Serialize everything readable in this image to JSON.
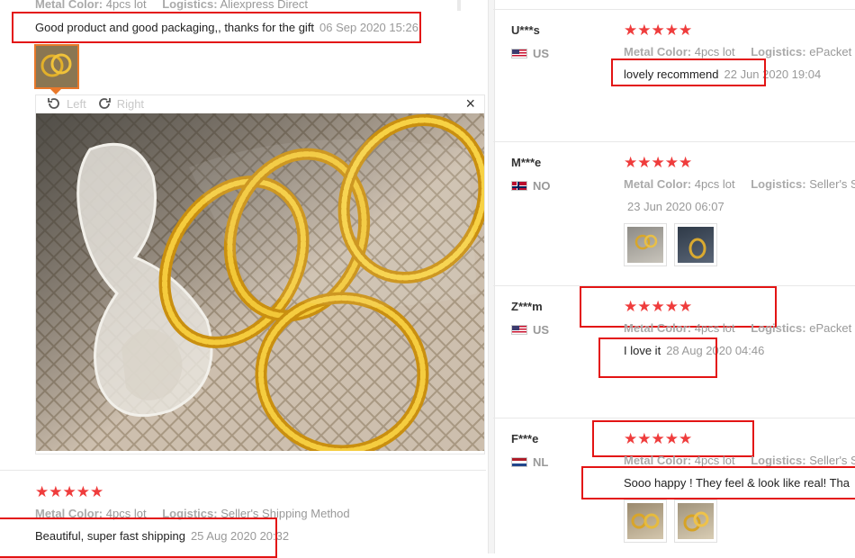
{
  "left_review_top": {
    "meta": {
      "color_label": "Metal Color:",
      "color_value": "4pcs lot",
      "logistics_label": "Logistics:",
      "logistics_value": "Aliexpress Direct"
    },
    "text": "Good product and good packaging,, thanks for the gift",
    "date": "06 Sep 2020 15:26"
  },
  "viewer": {
    "rotate_left": "Left",
    "rotate_right": "Right",
    "close": "×"
  },
  "left_review_bottom": {
    "stars": "★★★★★",
    "meta": {
      "color_label": "Metal Color:",
      "color_value": "4pcs lot",
      "logistics_label": "Logistics:",
      "logistics_value": "Seller's Shipping Method"
    },
    "text": "Beautiful, super fast shipping",
    "date": "25 Aug 2020 20:32"
  },
  "right_reviews": [
    {
      "user": "U***s",
      "country": "US",
      "stars": "★★★★★",
      "color_label": "Metal Color:",
      "color_value": "4pcs lot",
      "logistics_label": "Logistics:",
      "logistics_value": "ePacket",
      "text": "lovely recommend",
      "date": "22 Jun 2020 19:04"
    },
    {
      "user": "M***e",
      "country": "NO",
      "stars": "★★★★★",
      "color_label": "Metal Color:",
      "color_value": "4pcs lot",
      "logistics_label": "Logistics:",
      "logistics_value": "Seller's Sh",
      "text": "",
      "date": "23 Jun 2020 06:07"
    },
    {
      "user": "Z***m",
      "country": "US",
      "stars": "★★★★★",
      "color_label": "Metal Color:",
      "color_value": "4pcs lot",
      "logistics_label": "Logistics:",
      "logistics_value": "ePacket",
      "text": "I love it",
      "date": "28 Aug 2020 04:46"
    },
    {
      "user": "F***e",
      "country": "NL",
      "stars": "★★★★★",
      "color_label": "Metal Color:",
      "color_value": "4pcs lot",
      "logistics_label": "Logistics:",
      "logistics_value": "Seller's Sh",
      "text": "Sooo happy ! They feel & look like real! Tha",
      "date": ""
    }
  ],
  "colors": {
    "star": "#ef3c3c",
    "highlight": "#e31414",
    "meta_text": "#999999"
  }
}
